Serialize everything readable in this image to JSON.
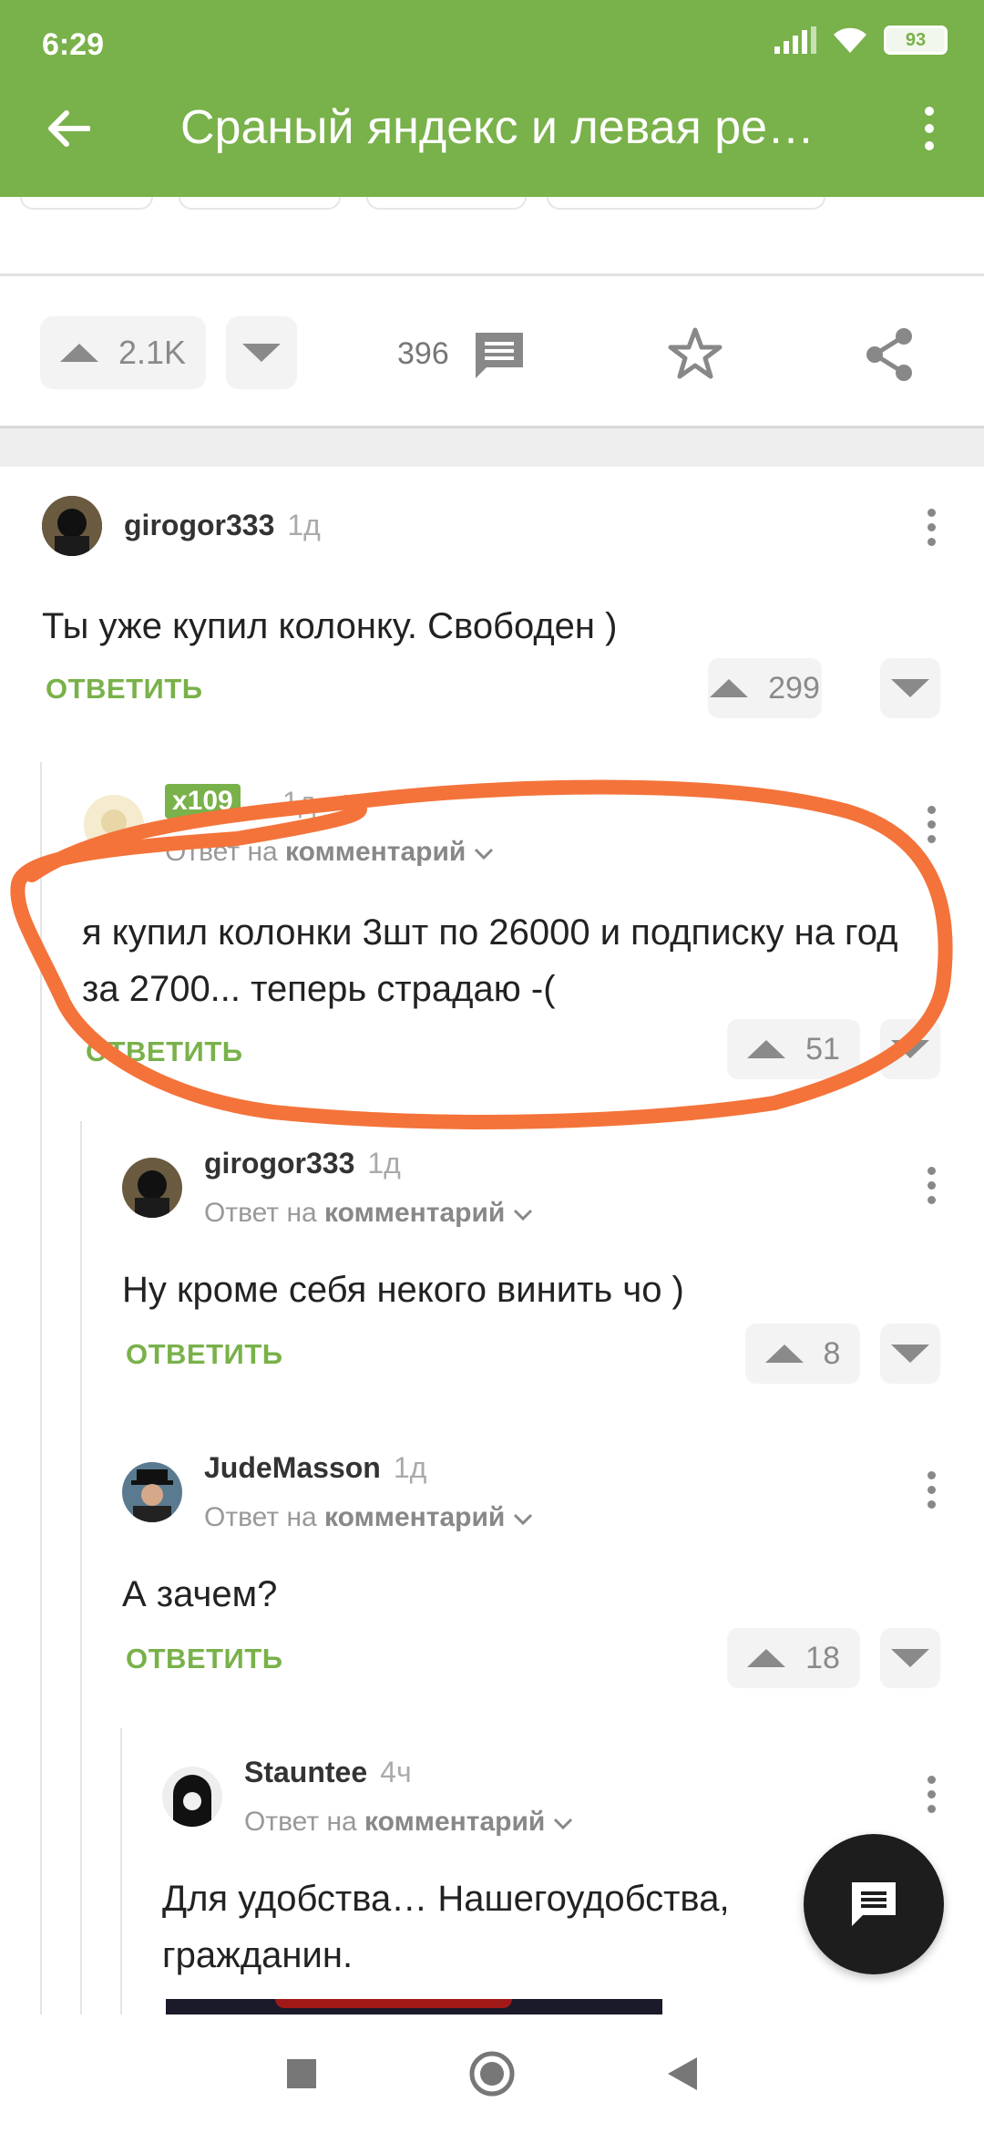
{
  "status_bar": {
    "time": "6:29",
    "battery": "93"
  },
  "app_bar": {
    "title": "Сраный яндекс и левая ре…"
  },
  "post_actions": {
    "upvotes": "2.1K",
    "comments": "396"
  },
  "comments": [
    {
      "author": "girogor333",
      "time": "1д",
      "reply_to_prefix": "",
      "reply_to_target": "",
      "text": "Ты уже купил колонку. Свободен )",
      "reply_label": "ОТВЕТИТЬ",
      "votes": "299"
    },
    {
      "author": "",
      "badge": "x109",
      "time": "1д",
      "reply_to_prefix": "Ответ на",
      "reply_to_target": "комментарий",
      "text": "я купил колонки 3шт по 26000 и подписку на год за 2700... теперь страдаю -(",
      "reply_label": "ОТВЕТИТЬ",
      "votes": "51"
    },
    {
      "author": "girogor333",
      "time": "1д",
      "reply_to_prefix": "Ответ на",
      "reply_to_target": "комментарий",
      "text": "Ну кроме себя некого винить чо )",
      "reply_label": "ОТВЕТИТЬ",
      "votes": "8"
    },
    {
      "author": "JudeMasson",
      "time": "1д",
      "reply_to_prefix": "Ответ на",
      "reply_to_target": "комментарий",
      "text": "А зачем?",
      "reply_label": "ОТВЕТИТЬ",
      "votes": "18"
    },
    {
      "author": "Stauntee",
      "time": "4ч",
      "reply_to_prefix": "Ответ на",
      "reply_to_target": "комментарий",
      "text": "Для удобства… Нашегоудобства, гражданин.",
      "reply_label": "",
      "votes": ""
    }
  ],
  "annotation": {
    "color": "#f4733a"
  },
  "colors": {
    "accent": "#79b14a"
  }
}
